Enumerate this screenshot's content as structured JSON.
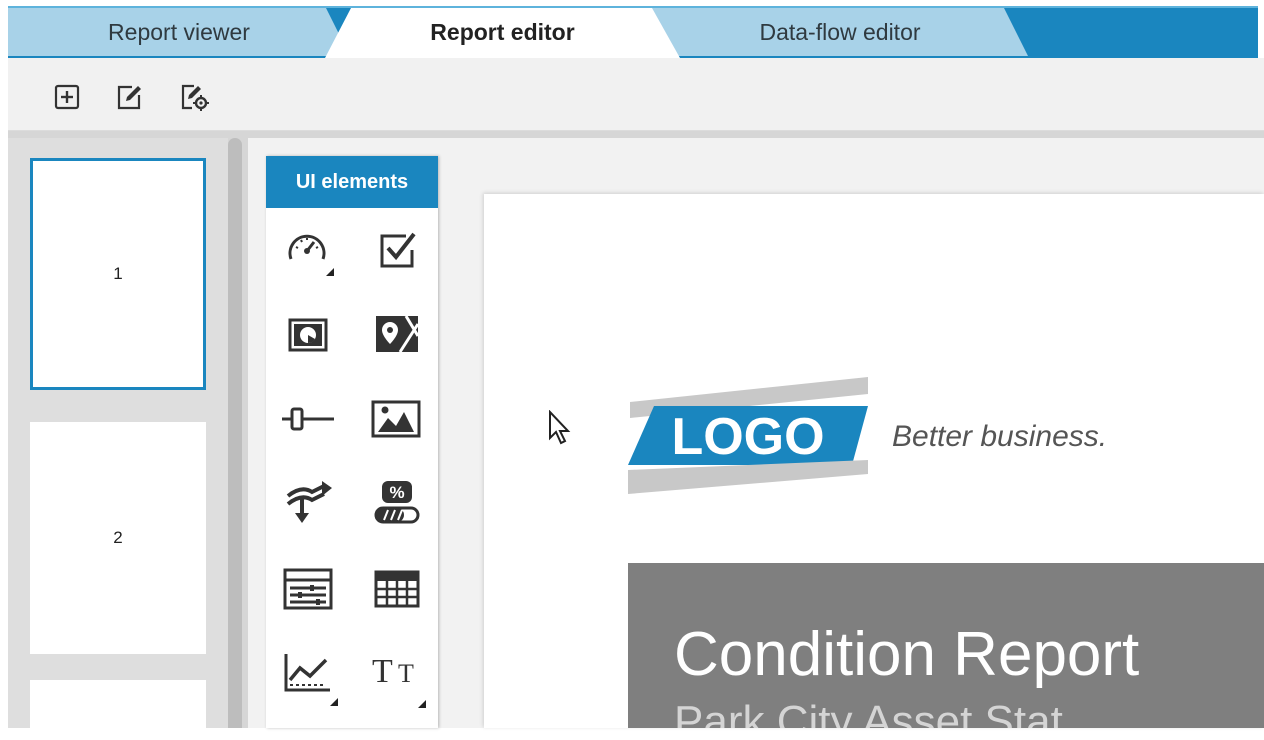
{
  "tabs": [
    {
      "label": "Report viewer",
      "active": false
    },
    {
      "label": "Report editor",
      "active": true
    },
    {
      "label": "Data-flow editor",
      "active": false
    }
  ],
  "toolbar": {
    "buttons": [
      {
        "icon": "add-square-icon"
      },
      {
        "icon": "edit-square-icon"
      },
      {
        "icon": "page-settings-icon"
      }
    ]
  },
  "pages_panel": {
    "pages": [
      {
        "number": "1",
        "selected": true
      },
      {
        "number": "2",
        "selected": false
      },
      {
        "number": "",
        "selected": false
      }
    ]
  },
  "ui_elements": {
    "header": "UI elements",
    "items": [
      "gauge-icon",
      "checkbox-icon",
      "chart-frame-icon",
      "map-icon",
      "slider-icon",
      "image-icon",
      "data-flow-icon",
      "percent-progress-icon",
      "list-icon",
      "table-icon",
      "line-chart-icon",
      "text-icon"
    ]
  },
  "report": {
    "logo_text": "LOGO",
    "tagline": "Better business.",
    "title": "Condition Report",
    "subtitle": "Park City Asset Stat"
  },
  "colors": {
    "accent": "#1a86bf",
    "banner": "#7f7f7f",
    "panel": "#dedede"
  }
}
